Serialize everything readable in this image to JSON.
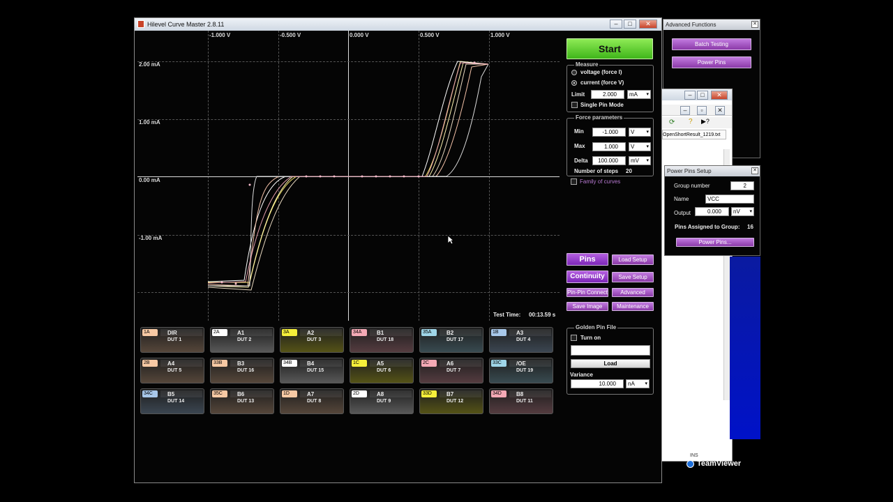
{
  "main_window": {
    "title": "Hilevel Curve Master 2.8.11"
  },
  "plot": {
    "x_ticks": [
      "-1.000 V",
      "-0.500 V",
      "0.000 V",
      "0.500 V",
      "1.000 V"
    ],
    "y_ticks": [
      "2.00 mA",
      "1.00 mA",
      "0.00 mA",
      "-1.00 mA"
    ],
    "test_time_label": "Test Time:",
    "test_time_value": "00:13.59 s"
  },
  "controls": {
    "start_label": "Start",
    "measure": {
      "title": "Measure",
      "opt_voltage": "voltage (force I)",
      "opt_current": "current (force V)",
      "limit_label": "Limit",
      "limit_value": "2.000",
      "limit_unit": "mA",
      "single_pin_label": "Single Pin Mode"
    },
    "force": {
      "title": "Force parameters",
      "min_label": "Min",
      "min_value": "-1.000",
      "min_unit": "V",
      "max_label": "Max",
      "max_value": "1.000",
      "max_unit": "V",
      "delta_label": "Delta",
      "delta_value": "100.000",
      "delta_unit": "mV",
      "steps_label": "Number of steps",
      "steps_value": "20"
    },
    "family_label": "Family of curves",
    "buttons": {
      "pins": "Pins",
      "load_setup": "Load Setup",
      "continuity": "Continuity",
      "save_setup": "Save Setup",
      "pin_pin": "Pin-Pin Connect",
      "advanced": "Advanced",
      "save_image": "Save Image",
      "maintenance": "Maintenance"
    },
    "golden": {
      "title": "Golden Pin File",
      "turn_on": "Turn on",
      "load": "Load",
      "variance_label": "Variance",
      "variance_value": "10.000",
      "variance_unit": "nA"
    }
  },
  "pins": [
    {
      "tag": "1A",
      "color": "#f7c9a4",
      "name": "DIR",
      "dut": "DUT 1"
    },
    {
      "tag": "2A",
      "color": "#ffffff",
      "name": "A1",
      "dut": "DUT 2"
    },
    {
      "tag": "3A",
      "color": "#f5ef3a",
      "name": "A2",
      "dut": "DUT 3"
    },
    {
      "tag": "34A",
      "color": "#f4a9b5",
      "name": "B1",
      "dut": "DUT 18"
    },
    {
      "tag": "35A",
      "color": "#9fd6e8",
      "name": "B2",
      "dut": "DUT 17"
    },
    {
      "tag": "1B",
      "color": "#a8c8ea",
      "name": "A3",
      "dut": "DUT 4"
    },
    {
      "tag": "2B",
      "color": "#f7c9a4",
      "name": "A4",
      "dut": "DUT 5"
    },
    {
      "tag": "33B",
      "color": "#f7c9a4",
      "name": "B3",
      "dut": "DUT 16"
    },
    {
      "tag": "34B",
      "color": "#ffffff",
      "name": "B4",
      "dut": "DUT 15"
    },
    {
      "tag": "1C",
      "color": "#f5ef3a",
      "name": "A5",
      "dut": "DUT 6"
    },
    {
      "tag": "2C",
      "color": "#f4a9b5",
      "name": "A6",
      "dut": "DUT 7"
    },
    {
      "tag": "33C",
      "color": "#9fd6e8",
      "name": "/OE",
      "dut": "DUT 19"
    },
    {
      "tag": "34C",
      "color": "#a8c8ea",
      "name": "B5",
      "dut": "DUT 14"
    },
    {
      "tag": "35C",
      "color": "#f7c9a4",
      "name": "B6",
      "dut": "DUT 13"
    },
    {
      "tag": "1D",
      "color": "#f7c9a4",
      "name": "A7",
      "dut": "DUT 8"
    },
    {
      "tag": "2D",
      "color": "#ffffff",
      "name": "A8",
      "dut": "DUT 9"
    },
    {
      "tag": "33D",
      "color": "#f5ef3a",
      "name": "B7",
      "dut": "DUT 12"
    },
    {
      "tag": "34D",
      "color": "#f4a9b5",
      "name": "B8",
      "dut": "DUT 11"
    }
  ],
  "advanced_window": {
    "title": "Advanced Functions",
    "batch_label": "Batch Testing",
    "power_label": "Power Pins"
  },
  "file_window": {
    "file_name": "OpenShortResult_1219.txt",
    "status": "INS"
  },
  "power_window": {
    "title": "Power Pins Setup",
    "group_label": "Group number",
    "group_value": "2",
    "name_label": "Name",
    "name_value": "VCC",
    "output_label": "Output",
    "output_value": "0.000",
    "output_unit": "nV",
    "assigned_label": "Pins Assigned to Group:",
    "assigned_value": "16",
    "button_label": "Power Pins..."
  },
  "teamviewer": {
    "label": "TeamViewer"
  }
}
